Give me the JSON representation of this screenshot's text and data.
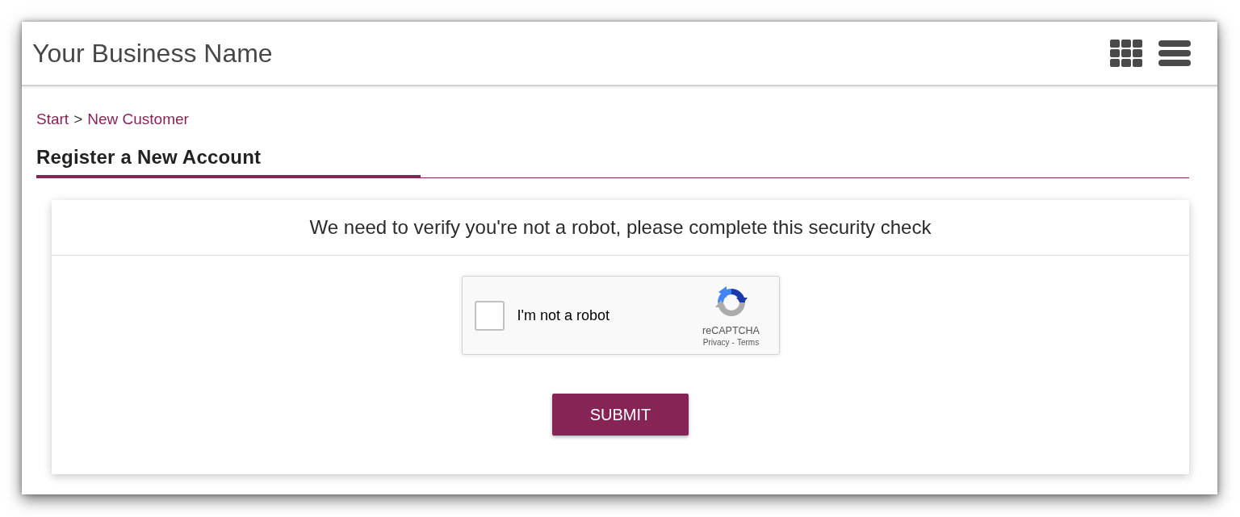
{
  "header": {
    "title": "Your Business Name"
  },
  "breadcrumb": [
    {
      "kind": "link",
      "label": "Start"
    },
    {
      "kind": "separator",
      "label": ">"
    },
    {
      "kind": "link",
      "label": "New Customer"
    }
  ],
  "page_title": "Register a New Account",
  "card": {
    "message": "We need to verify you're not a robot, please complete this security check",
    "captcha": {
      "label": "I'm not a robot",
      "checked": false,
      "brand": "reCAPTCHA",
      "privacy_link": "Privacy",
      "link_separator": "-",
      "terms_link": "Terms"
    },
    "submit_button": "SUBMIT"
  }
}
